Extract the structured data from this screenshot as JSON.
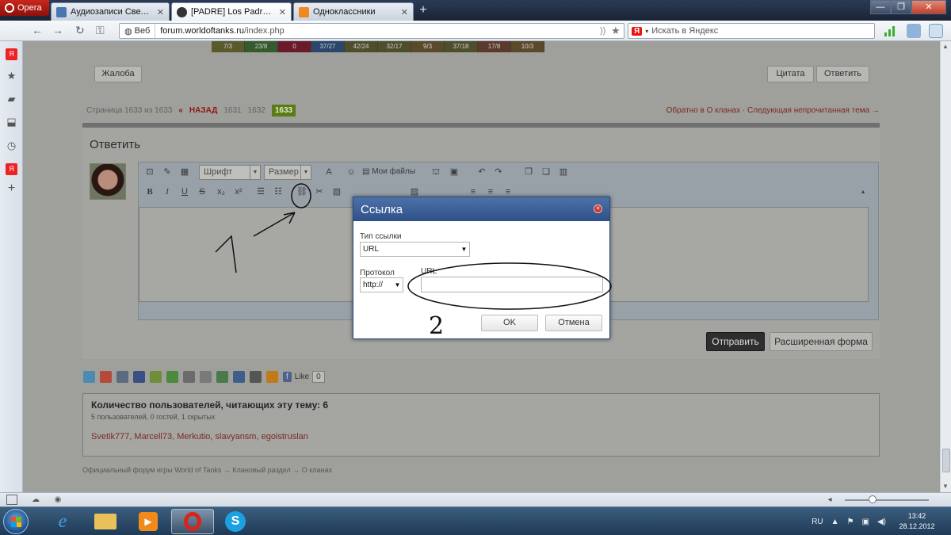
{
  "browser": {
    "menu_label": "Opera",
    "tabs": [
      {
        "label": "Аудиозаписи Светлан...",
        "close": "✕"
      },
      {
        "label": "[PADRE] Los Padres - O...",
        "close": "✕"
      },
      {
        "label": "Одноклассники",
        "close": "✕"
      }
    ],
    "new_tab": "+",
    "address": {
      "badge": "Веб",
      "url_host": "forum.worldoftanks.ru",
      "url_path": "/index.php"
    },
    "search": {
      "badge": "Я",
      "placeholder": "Искать в Яндекс"
    },
    "window_controls": {
      "min": "—",
      "max": "❐",
      "close": "✕"
    }
  },
  "forum": {
    "stats_strip": [
      "7/3",
      "23/8",
      "0",
      "37/27",
      "42/24",
      "32/17",
      "9/3",
      "37/18",
      "17/8",
      "10/3"
    ],
    "report_button": "Жалоба",
    "quote_button": "Цитата",
    "reply_button": "Ответить",
    "pager": {
      "label": "Страница 1633 из 1633",
      "prev": "«",
      "back": "НАЗАД",
      "pages": [
        "1631",
        "1632"
      ],
      "current": "1633"
    },
    "clan_links": "Обратно в О кланах · Следующая непрочитанная тема →",
    "reply_title": "Ответить",
    "editor": {
      "font_select": "Шрифт",
      "size_select": "Размер",
      "my_files": "Мои файлы"
    },
    "send_button": "Отправить",
    "advanced_button": "Расширенная форма",
    "like": {
      "label": "Like",
      "count": "0"
    },
    "readers": {
      "heading": "Количество пользователей, читающих эту тему: 6",
      "sub": "5 пользователей, 0 гостей, 1 скрытых",
      "names": "Svetik777, Marcell73, Merkutio, slavyansm, egoistruslan"
    },
    "breadcrumb": "Официальный форум игры World of Tanks  →  Клановый раздел  →  О кланах"
  },
  "dialog": {
    "title": "Ссылка",
    "link_type_label": "Тип ссылки",
    "link_type_value": "URL",
    "protocol_label": "Протокол",
    "protocol_value": "http://",
    "url_label": "URL",
    "url_value": "",
    "ok": "OK",
    "cancel": "Отмена"
  },
  "annotations": {
    "mark_1": "1",
    "mark_2": "2"
  },
  "system": {
    "lang": "RU",
    "time": "13:42",
    "date": "28.12.2012"
  }
}
